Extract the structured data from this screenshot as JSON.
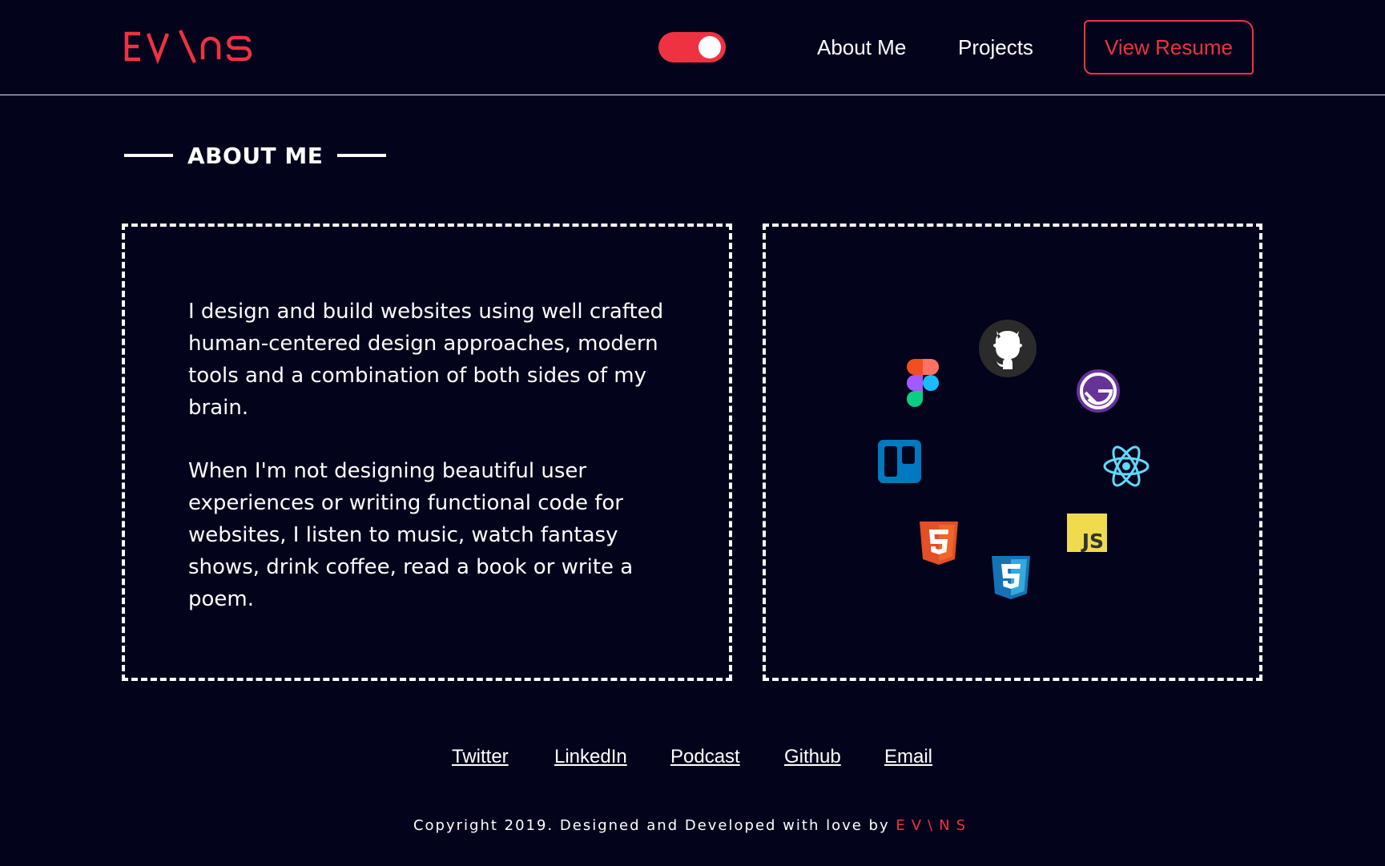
{
  "header": {
    "logo_text": "EV\\NS",
    "theme_toggle": {
      "state": "on",
      "color": "#ef3241"
    },
    "nav": [
      {
        "label": "About Me"
      },
      {
        "label": "Projects"
      }
    ],
    "resume_button": "View Resume"
  },
  "section": {
    "title": "ABOUT ME"
  },
  "about": {
    "paragraphs": [
      "I design and build websites using well crafted human-centered design approaches, modern tools and a combination of both sides of my brain.",
      "When I'm not designing beautiful user experiences or writing functional code for websites, I listen to music, watch fantasy shows, drink coffee, read a book or write a poem."
    ]
  },
  "tools": [
    {
      "icon": "figma-icon"
    },
    {
      "icon": "github-icon"
    },
    {
      "icon": "gatsby-icon"
    },
    {
      "icon": "trello-icon"
    },
    {
      "icon": "react-icon"
    },
    {
      "icon": "html5-icon"
    },
    {
      "icon": "javascript-icon"
    },
    {
      "icon": "css3-icon"
    }
  ],
  "footer": {
    "links": [
      "Twitter",
      "LinkedIn",
      "Podcast",
      "Github",
      "Email"
    ],
    "copyright_prefix": "Copyright 2019. Designed and Developed with love by",
    "copyright_brand": "EV\\NS"
  },
  "colors": {
    "background": "#03031c",
    "accent": "#ef3241",
    "text": "#ffffff"
  }
}
